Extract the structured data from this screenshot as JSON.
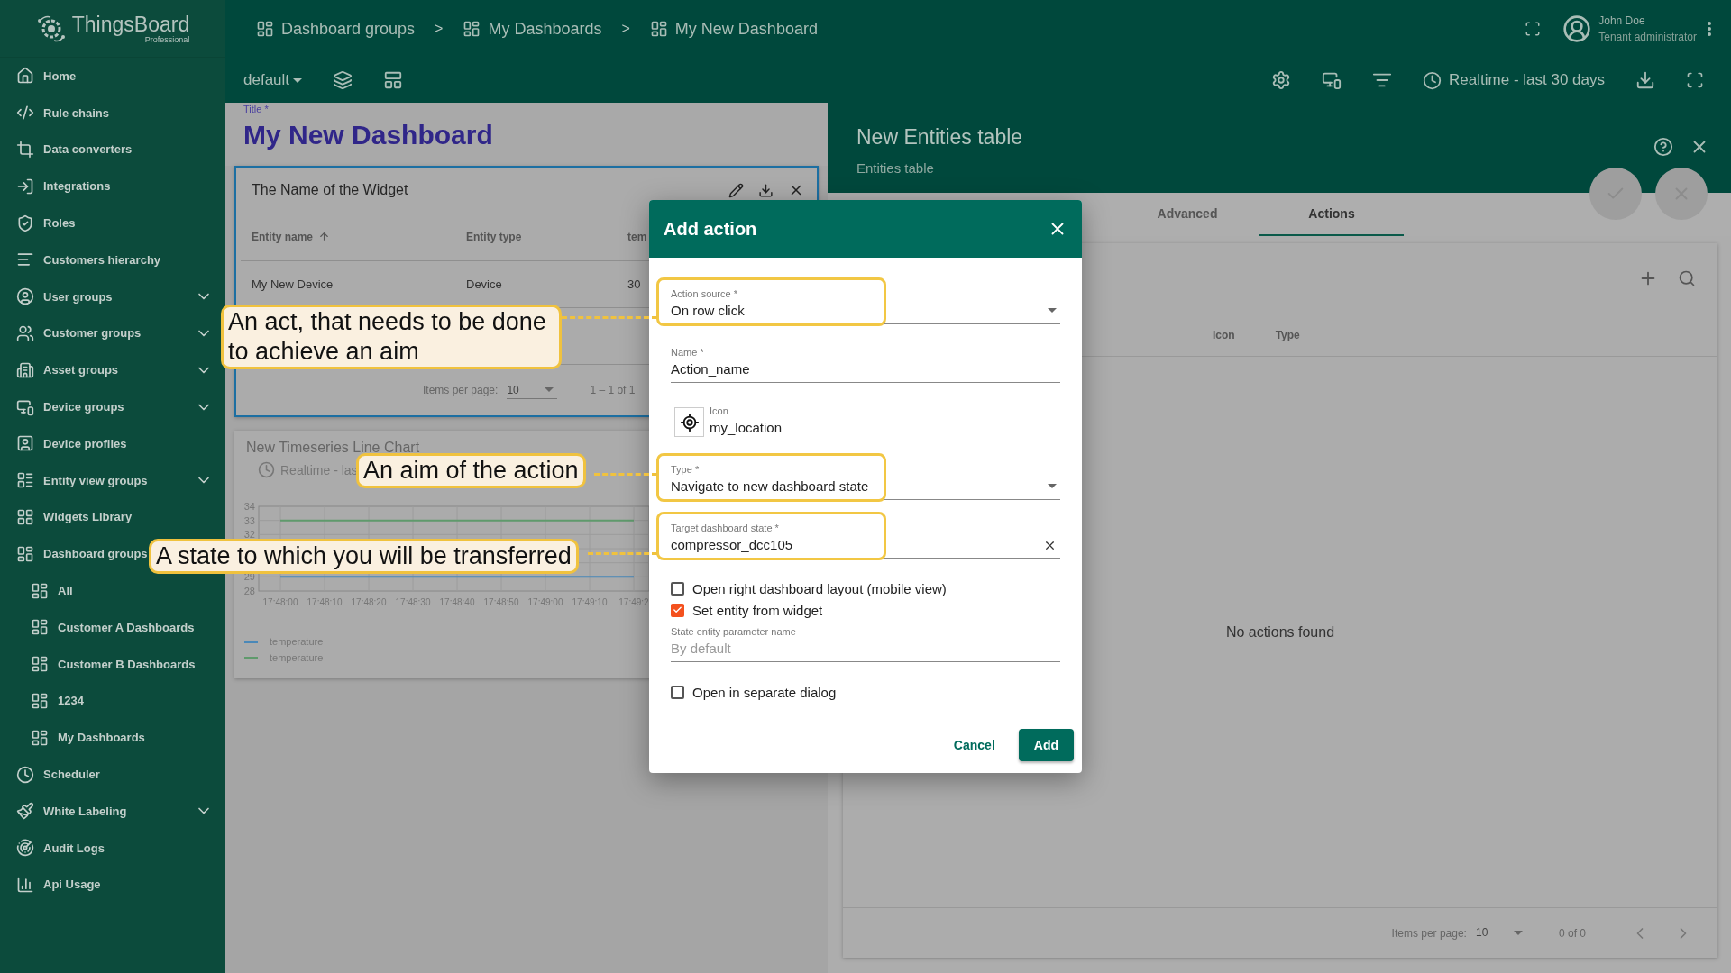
{
  "logo": {
    "name": "ThingsBoard",
    "edition": "Professional"
  },
  "breadcrumbs": [
    {
      "label": "Dashboard groups",
      "separator": ">"
    },
    {
      "label": "My Dashboards",
      "separator": ">"
    },
    {
      "label": "My New Dashboard"
    }
  ],
  "user": {
    "name": "John Doe",
    "role": "Tenant administrator"
  },
  "toolbar": {
    "layout": "default",
    "timewindow": "Realtime - last 30 days"
  },
  "sidebar": {
    "items": [
      {
        "label": "Home",
        "expandable": false
      },
      {
        "label": "Rule chains",
        "expandable": false
      },
      {
        "label": "Data converters",
        "expandable": false
      },
      {
        "label": "Integrations",
        "expandable": false
      },
      {
        "label": "Roles",
        "expandable": false
      },
      {
        "label": "Customers hierarchy",
        "expandable": false
      },
      {
        "label": "User groups",
        "expandable": true
      },
      {
        "label": "Customer groups",
        "expandable": true
      },
      {
        "label": "Asset groups",
        "expandable": true
      },
      {
        "label": "Device groups",
        "expandable": true
      },
      {
        "label": "Device profiles",
        "expandable": false
      },
      {
        "label": "Entity view groups",
        "expandable": true
      },
      {
        "label": "Widgets Library",
        "expandable": false
      },
      {
        "label": "Dashboard groups",
        "expandable": false,
        "children": [
          {
            "label": "All"
          },
          {
            "label": "Customer A Dashboards"
          },
          {
            "label": "Customer B Dashboards"
          },
          {
            "label": "1234"
          },
          {
            "label": "My Dashboards"
          }
        ]
      },
      {
        "label": "Scheduler",
        "expandable": false
      },
      {
        "label": "White Labeling",
        "expandable": true
      },
      {
        "label": "Audit Logs",
        "expandable": false
      },
      {
        "label": "Api Usage",
        "expandable": false
      }
    ]
  },
  "dashboard": {
    "title_label": "Title *",
    "title": "My New Dashboard",
    "table_widget": {
      "title": "The Name of the Widget",
      "columns": [
        {
          "label": "Entity name",
          "sorted": true
        },
        {
          "label": "Entity type",
          "sorted": false
        },
        {
          "label": "tem",
          "sorted": false
        }
      ],
      "rows": [
        [
          "My New Device",
          "Device",
          "30"
        ]
      ],
      "paginator": {
        "label": "Items per page:",
        "page_size": "10",
        "range": "1 – 1 of 1"
      }
    },
    "chart_widget": {
      "title": "New Timeseries Line Chart",
      "timewindow": "Realtime - las",
      "chart_data": {
        "type": "line",
        "grid": true,
        "categories": [
          "17:48:00",
          "17:48:10",
          "17:48:20",
          "17:48:30",
          "17:48:40",
          "17:48:50",
          "17:49:00",
          "17:49:10",
          "17:49:2"
        ],
        "ylim": [
          28,
          34
        ],
        "yticks": [
          28,
          29,
          32,
          33,
          34
        ],
        "series": [
          {
            "name": "temperature",
            "color": "#4a88b8",
            "values": [
              29,
              29,
              29,
              29,
              29,
              29,
              29,
              29,
              29
            ]
          },
          {
            "name": "temperature",
            "color": "#5f9a6c",
            "values": [
              33,
              33,
              33,
              33,
              33,
              33,
              33,
              33,
              33
            ]
          }
        ]
      }
    }
  },
  "right_panel": {
    "title": "New Entities table",
    "subtitle": "Entities table",
    "tabs": [
      {
        "label": "Advanced",
        "selected": false
      },
      {
        "label": "Actions",
        "selected": true
      }
    ],
    "columns": [
      "Icon",
      "Type"
    ],
    "empty_message": "No actions found",
    "paginator": {
      "label": "Items per page:",
      "page_size": "10",
      "range": "0 of 0"
    }
  },
  "dialog": {
    "title": "Add action",
    "fields": [
      {
        "kind": "select",
        "label": "Action source *",
        "value": "On row click",
        "highlighted": true
      },
      {
        "kind": "text",
        "label": "Name *",
        "value": "Action_name",
        "highlighted": false
      },
      {
        "kind": "icon",
        "label": "Icon",
        "value": "my_location",
        "highlighted": false
      },
      {
        "kind": "select",
        "label": "Type *",
        "value": "Navigate to new dashboard state",
        "highlighted": true
      },
      {
        "kind": "clearable",
        "label": "Target dashboard state *",
        "value": "compressor_dcc105",
        "highlighted": true
      },
      {
        "kind": "checkbox",
        "label": "Open right dashboard layout (mobile view)",
        "checked": false
      },
      {
        "kind": "checkbox",
        "label": "Set entity from widget",
        "checked": true
      },
      {
        "kind": "text",
        "label": "State entity parameter name",
        "placeholder": "By default",
        "highlighted": false
      },
      {
        "kind": "checkbox",
        "label": "Open in separate dialog",
        "checked": false
      }
    ],
    "buttons": [
      {
        "label": "Cancel",
        "kind": "flat"
      },
      {
        "label": "Add",
        "kind": "raised"
      }
    ]
  },
  "callouts": [
    {
      "text": "An act, that needs to be done to achieve an aim"
    },
    {
      "text": "An aim of the action"
    },
    {
      "text": "A state to which you will be transferred"
    }
  ]
}
